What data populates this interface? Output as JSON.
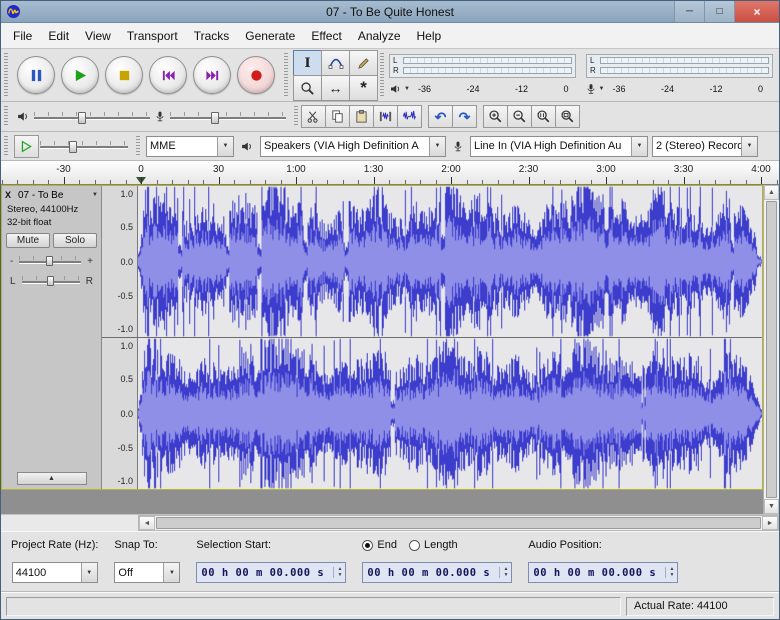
{
  "window": {
    "title": "07 - To Be Quite Honest"
  },
  "icons": {
    "caption_minimize": "─",
    "caption_maximize": "□",
    "caption_close": "×",
    "combo_arrow": "▼",
    "spin_up": "▲",
    "spin_down": "▼",
    "undo": "↶",
    "redo": "↷",
    "scroll_left": "◄",
    "scroll_right": "►",
    "scroll_up": "▲",
    "scroll_down": "▼",
    "collapse": "▲",
    "selection_tool": "I",
    "timeshift_tool": "↔",
    "multi_tool": "*"
  },
  "menu": {
    "items": [
      "File",
      "Edit",
      "View",
      "Transport",
      "Tracks",
      "Generate",
      "Effect",
      "Analyze",
      "Help"
    ]
  },
  "meters": {
    "channel_labels": [
      "L",
      "R"
    ],
    "scale_labels": [
      "-36",
      "-24",
      "-12",
      "0"
    ]
  },
  "device": {
    "host": "MME",
    "output": "Speakers (VIA High Definition A",
    "input": "Line In (VIA High Definition Au",
    "channels": "2 (Stereo) Record"
  },
  "timeline": {
    "labels": [
      "-30",
      "0",
      "30",
      "1:00",
      "1:30",
      "2:00",
      "2:30",
      "3:00",
      "3:30",
      "4:00"
    ]
  },
  "track": {
    "close": "X",
    "name": "07 - To Be",
    "info_format": "Stereo, 44100Hz",
    "info_depth": "32-bit float",
    "mute_label": "Mute",
    "solo_label": "Solo",
    "gain_minus": "-",
    "gain_plus": "+",
    "pan_left": "L",
    "pan_right": "R",
    "vruler_labels": [
      "1.0",
      "0.5",
      "0.0",
      "-0.5",
      "-1.0"
    ]
  },
  "waveform": {
    "background": "#e7e7ea",
    "peak_color": "#3c3ccd",
    "rms_color": "#8f8fe8",
    "seed": 1234
  },
  "selection": {
    "project_rate_label": "Project Rate (Hz):",
    "project_rate": "44100",
    "snap_label": "Snap To:",
    "snap_value": "Off",
    "start_label": "Selection Start:",
    "end_label": "End",
    "length_label": "Length",
    "audio_pos_label": "Audio Position:",
    "start_value": "00 h 00 m 00.000 s",
    "end_value": "00 h 00 m 00.000 s",
    "audio_pos_value": "00 h 00 m 00.000 s"
  },
  "status": {
    "actual_rate": "Actual Rate: 44100"
  }
}
